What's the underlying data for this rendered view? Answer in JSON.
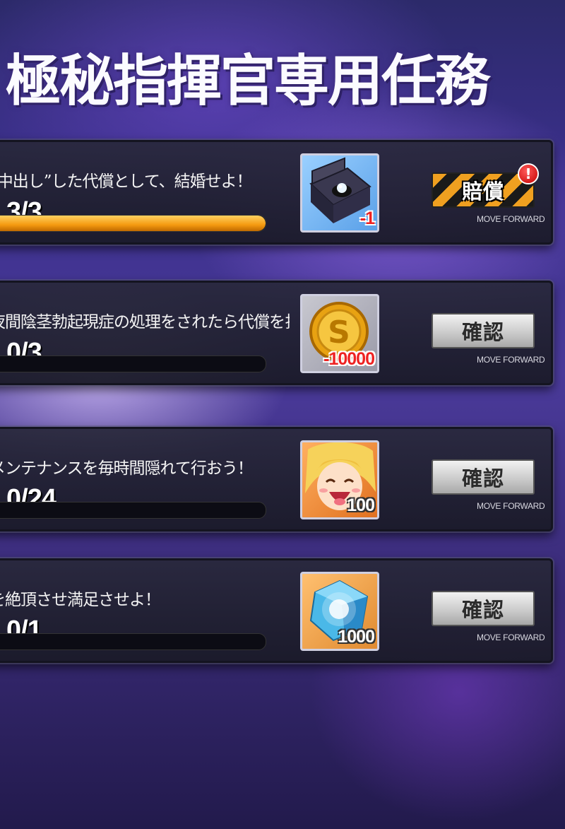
{
  "title": "極秘指揮官専用任務",
  "quests": [
    {
      "text": "”中出し”した代償として、結婚せよ！",
      "progress": "3/3",
      "progress_fraction": 1.0,
      "reward_icon": "ring-box-icon",
      "reward_count": "-1",
      "button_label": "賠償",
      "button_style": "hazard",
      "alert": "!",
      "move_forward": "MOVE FORWARD"
    },
    {
      "text": "夜間陰茎勃起現症の処理をされたら代償を払え！",
      "progress": "0/3",
      "progress_fraction": 0.0,
      "reward_icon": "gold-coin-icon",
      "reward_count": "-10000",
      "button_label": "確認",
      "button_style": "normal",
      "move_forward": "MOVE FORWARD"
    },
    {
      "text": "メンテナンスを毎時間隠れて行おう！",
      "progress": "0/24",
      "progress_fraction": 0.0,
      "reward_icon": "character-portrait-icon",
      "reward_count": "100",
      "button_label": "確認",
      "button_style": "normal",
      "move_forward": "MOVE FORWARD"
    },
    {
      "text": "を絶頂させ満足させよ！",
      "progress": "0/1",
      "progress_fraction": 0.0,
      "reward_icon": "blue-cube-icon",
      "reward_count": "1000",
      "button_label": "確認",
      "button_style": "normal",
      "move_forward": "MOVE FORWARD"
    }
  ]
}
